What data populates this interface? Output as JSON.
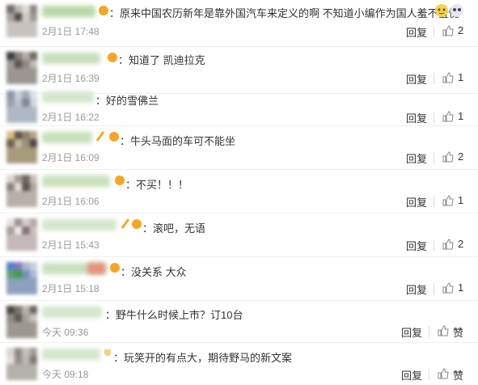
{
  "comments": [
    {
      "text": "：原来中国农历新年是靠外国汽车来定义的啊 不知道小编作为国人羞不羞愧",
      "date": "2月1日 17:48",
      "reply": "回复",
      "likes": "2"
    },
    {
      "text": "：知道了  凯迪拉克",
      "date": "2月1日 16:39",
      "reply": "回复",
      "likes": "1"
    },
    {
      "text": "：好的雪佛兰",
      "date": "2月1日 16:22",
      "reply": "回复",
      "likes": "1"
    },
    {
      "text": "：牛头马面的车可不能坐",
      "date": "2月1日 16:09",
      "reply": "回复",
      "likes": "2"
    },
    {
      "text": "：不买！！！",
      "date": "2月1日 16:06",
      "reply": "回复",
      "likes": "1"
    },
    {
      "text": "：滚吧，无语",
      "date": "2月1日 15:43",
      "reply": "回复",
      "likes": "2"
    },
    {
      "text": "：没关系 大众",
      "date": "2月1日 15:18",
      "reply": "回复",
      "likes": "1"
    },
    {
      "text": "：野牛什么时候上市？订10台",
      "date": "今天 09:36",
      "reply": "回复",
      "likes": "赞"
    },
    {
      "text": "：玩笑开的有点大，期待野马的新文案",
      "date": "今天 09:18",
      "reply": "回复",
      "likes": "赞"
    }
  ],
  "colors": {
    "text": "#333333",
    "meta": "#999999",
    "badge": "#f5a623",
    "divider": "#efefef"
  }
}
